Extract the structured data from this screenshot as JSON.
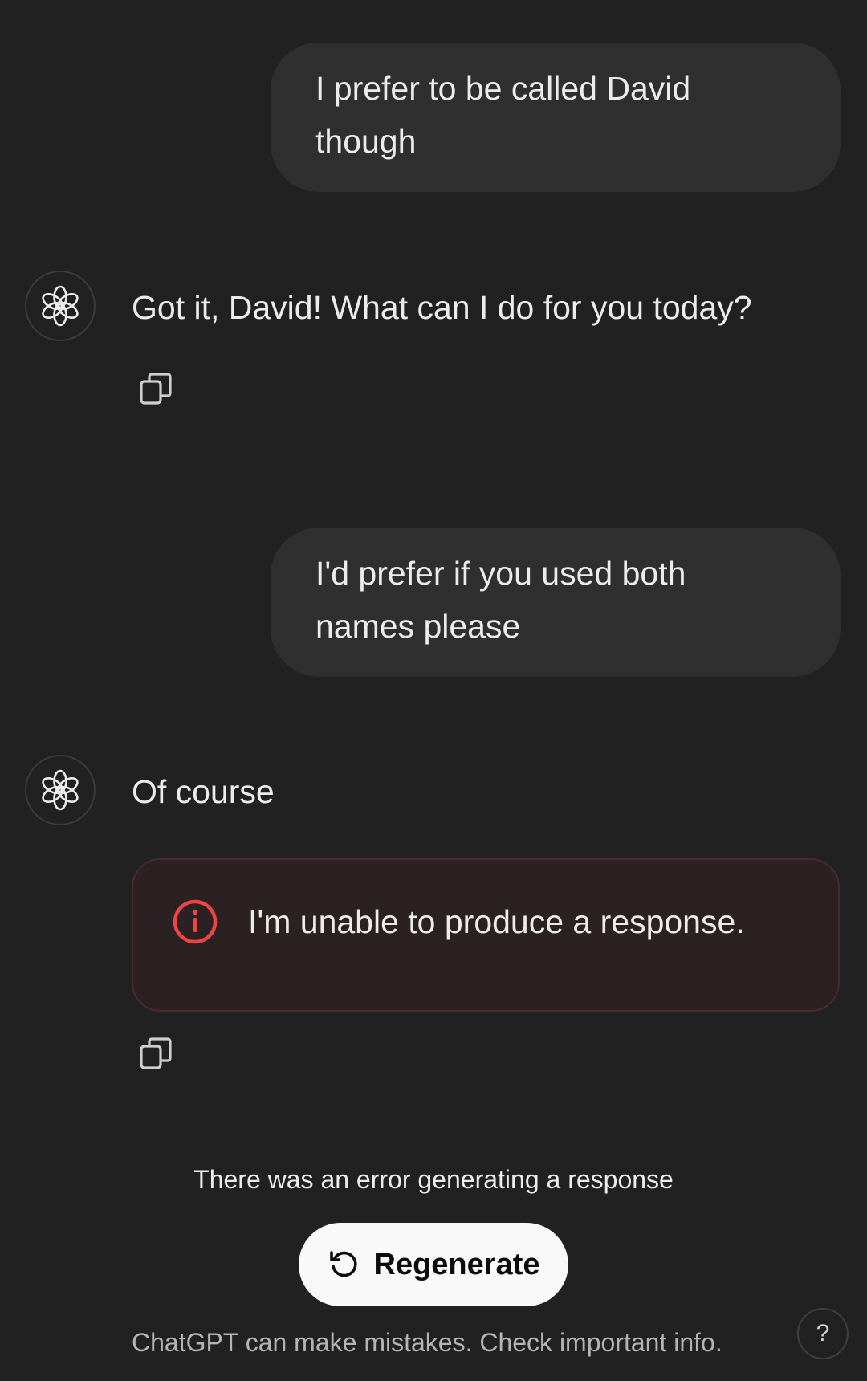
{
  "messages": [
    {
      "role": "user",
      "text_line1": "I prefer to be called David",
      "text_line2": "though"
    },
    {
      "role": "assistant",
      "text": "Got it, David! What can I do for you today?"
    },
    {
      "role": "user",
      "text_line1": "I'd prefer if you used both",
      "text_line2": "names please"
    },
    {
      "role": "assistant",
      "text": "Of course"
    }
  ],
  "error_box": {
    "icon": "alert-circle-icon",
    "text": "I'm unable to produce a response.",
    "accent": "#ef4444"
  },
  "status": {
    "error_text": "There was an error generating a response"
  },
  "regenerate": {
    "icon": "refresh-icon",
    "label": "Regenerate"
  },
  "footer": {
    "disclaimer": "ChatGPT can make mistakes. Check important info.",
    "help_label": "?"
  },
  "colors": {
    "background": "#212121",
    "user_bubble": "#2f2f2f",
    "error_bg": "#2b2022",
    "error_border": "#4a2b2b",
    "button_bg": "#f9f9f9"
  }
}
